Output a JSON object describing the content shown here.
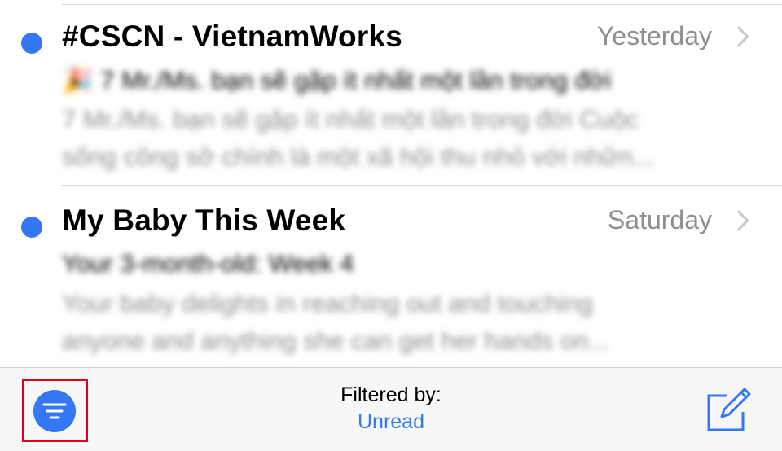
{
  "messages": [
    {
      "sender": "#CSCN - VietnamWorks",
      "date": "Yesterday",
      "unread": true,
      "subject": "🎉 7 Mr./Ms. bạn sẽ gặp ít nhất một lần trong đời",
      "preview_line1": "7 Mr./Ms. bạn sẽ gặp ít nhất một lần trong đời Cuộc",
      "preview_line2": "sống công sở chính là một xã hội thu nhỏ với nhữn..."
    },
    {
      "sender": "My Baby This Week",
      "date": "Saturday",
      "unread": true,
      "subject": "Your 3-month-old: Week 4",
      "preview_line1": "Your baby delights in reaching out and touching",
      "preview_line2": "anyone and anything she can get her hands on..."
    }
  ],
  "toolbar": {
    "filter_icon": "filter-lines-icon",
    "filter_caption": "Filtered by:",
    "filter_value": "Unread",
    "compose_icon": "compose-icon"
  },
  "colors": {
    "accent": "#3478f6",
    "highlight": "#e0001b",
    "secondary_text": "#8e8e93"
  }
}
